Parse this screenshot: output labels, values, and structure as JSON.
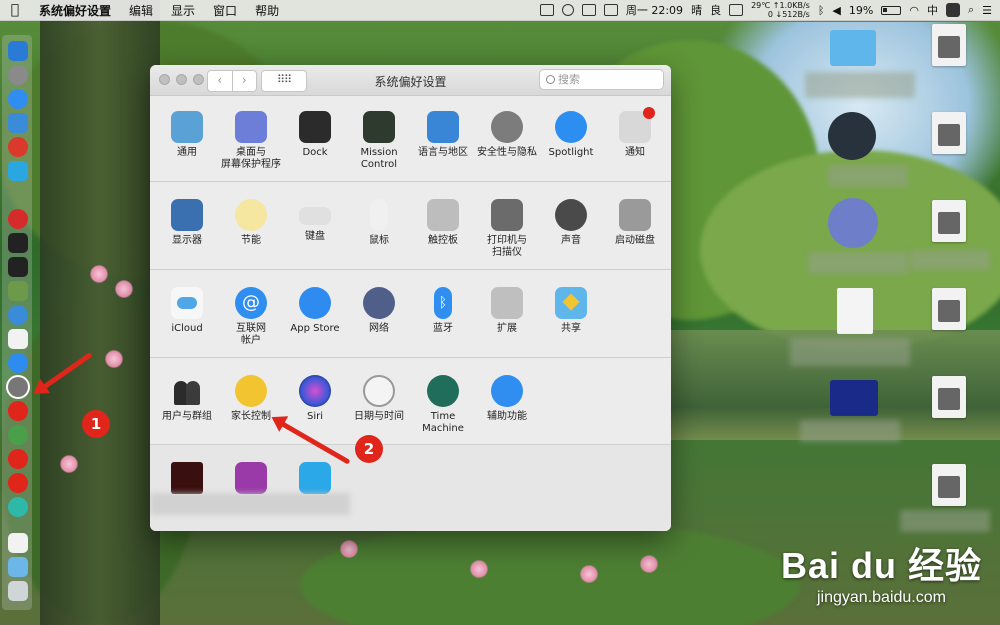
{
  "menubar": {
    "app": "系统偏好设置",
    "menus": [
      "编辑",
      "显示",
      "窗口",
      "帮助"
    ],
    "temp": "29℃",
    "net_up": "↑1.0KB/s",
    "net_down": "↓512B/s",
    "net_zero": "0",
    "clock": "周一 22:09",
    "weather": "晴",
    "air": "良",
    "battery": "19%",
    "input_method": "中"
  },
  "window": {
    "title": "系统偏好设置",
    "search_placeholder": "搜索",
    "grid_glyph": "⠿⠿",
    "back": "‹",
    "forward": "›",
    "rows": [
      [
        "通用",
        "桌面与\n屏幕保护程序",
        "Dock",
        "Mission\nControl",
        "语言与地区",
        "安全性与隐私",
        "Spotlight",
        "通知"
      ],
      [
        "显示器",
        "节能",
        "键盘",
        "鼠标",
        "触控板",
        "打印机与\n扫描仪",
        "声音",
        "启动磁盘"
      ],
      [
        "iCloud",
        "互联网\n帐户",
        "App Store",
        "网络",
        "蓝牙",
        "扩展",
        "共享"
      ],
      [
        "用户与群组",
        "家长控制",
        "Siri",
        "日期与时间",
        "Time Machine",
        "辅助功能"
      ]
    ]
  },
  "annotations": {
    "step1": "1",
    "step2": "2"
  },
  "watermark": {
    "brand": "Bai du 经验",
    "url": "jingyan.baidu.com"
  },
  "colors": {
    "accent": "#e0251b"
  }
}
